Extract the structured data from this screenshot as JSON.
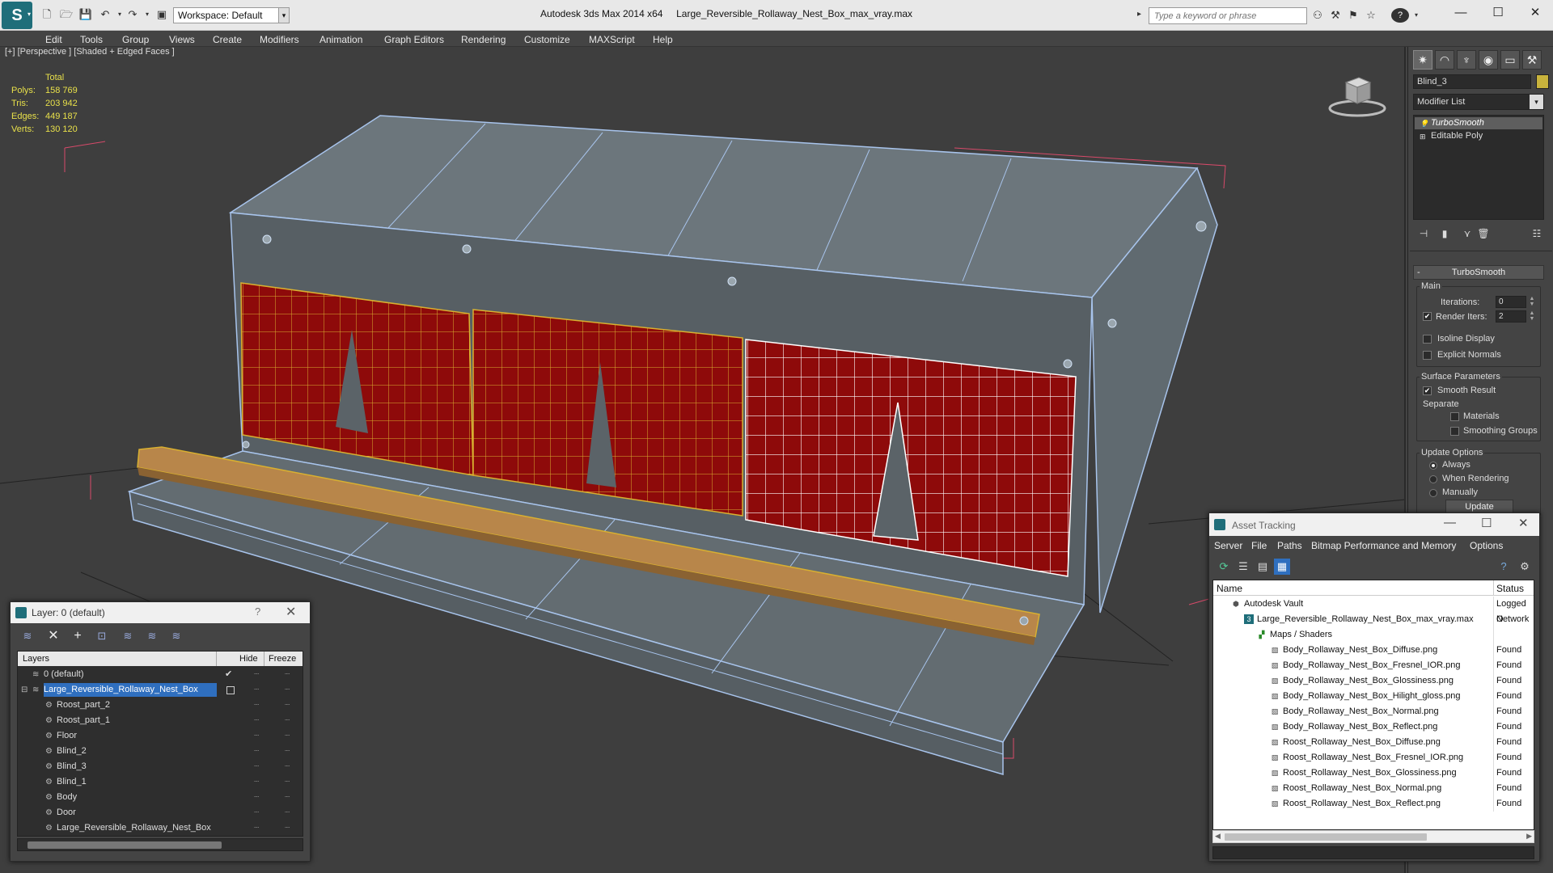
{
  "app": {
    "title": "Autodesk 3ds Max  2014 x64",
    "file": "Large_Reversible_Rollaway_Nest_Box_max_vray.max",
    "workspace": "Workspace: Default",
    "search_placeholder": "Type a keyword or phrase"
  },
  "menu": [
    "Edit",
    "Tools",
    "Group",
    "Views",
    "Create",
    "Modifiers",
    "Animation",
    "Graph Editors",
    "Rendering",
    "Customize",
    "MAXScript",
    "Help"
  ],
  "viewport": {
    "label": "[+] [Perspective ] [Shaded + Edged Faces ]",
    "stats": {
      "header": "Total",
      "rows": [
        {
          "label": "Polys:",
          "value": "158 769"
        },
        {
          "label": "Tris:",
          "value": "203 942"
        },
        {
          "label": "Edges:",
          "value": "449 187"
        },
        {
          "label": "Verts:",
          "value": "130 120"
        }
      ]
    }
  },
  "command_panel": {
    "object_name": "Blind_3",
    "modifier_list": "Modifier List",
    "stack": [
      "TurboSmooth",
      "Editable Poly"
    ],
    "rollout_title": "TurboSmooth",
    "main_label": "Main",
    "iterations_label": "Iterations:",
    "iterations_value": "0",
    "render_iters_label": "Render Iters:",
    "render_iters_value": "2",
    "isoline_label": "Isoline Display",
    "explicit_normals_label": "Explicit Normals",
    "surface_params_label": "Surface Parameters",
    "smooth_result_label": "Smooth Result",
    "separate_label": "Separate",
    "materials_label": "Materials",
    "smoothing_groups_label": "Smoothing Groups",
    "update_options_label": "Update Options",
    "always_label": "Always",
    "when_rendering_label": "When Rendering",
    "manually_label": "Manually",
    "update_button": "Update"
  },
  "layer_dialog": {
    "title": "Layer: 0 (default)",
    "help": "?",
    "col_layers": "Layers",
    "col_hide": "Hide",
    "col_freeze": "Freeze",
    "rows": [
      {
        "name": "0 (default)",
        "indent": 0
      },
      {
        "name": "Large_Reversible_Rollaway_Nest_Box",
        "indent": 0
      },
      {
        "name": "Roost_part_2",
        "indent": 1
      },
      {
        "name": "Roost_part_1",
        "indent": 1
      },
      {
        "name": "Floor",
        "indent": 1
      },
      {
        "name": "Blind_2",
        "indent": 1
      },
      {
        "name": "Blind_3",
        "indent": 1
      },
      {
        "name": "Blind_1",
        "indent": 1
      },
      {
        "name": "Body",
        "indent": 1
      },
      {
        "name": "Door",
        "indent": 1
      },
      {
        "name": "Large_Reversible_Rollaway_Nest_Box",
        "indent": 1
      }
    ]
  },
  "asset_dialog": {
    "title": "Asset Tracking",
    "menu": [
      "Server",
      "File",
      "Paths",
      "Bitmap Performance and Memory",
      "Options"
    ],
    "col_name": "Name",
    "col_status": "Status",
    "rows": [
      {
        "name": "Autodesk Vault",
        "status": "Logged O",
        "indent": 0
      },
      {
        "name": "Large_Reversible_Rollaway_Nest_Box_max_vray.max",
        "status": "Network",
        "indent": 1
      },
      {
        "name": "Maps / Shaders",
        "status": "",
        "indent": 2
      },
      {
        "name": "Body_Rollaway_Nest_Box_Diffuse.png",
        "status": "Found",
        "indent": 3
      },
      {
        "name": "Body_Rollaway_Nest_Box_Fresnel_IOR.png",
        "status": "Found",
        "indent": 3
      },
      {
        "name": "Body_Rollaway_Nest_Box_Glossiness.png",
        "status": "Found",
        "indent": 3
      },
      {
        "name": "Body_Rollaway_Nest_Box_Hilight_gloss.png",
        "status": "Found",
        "indent": 3
      },
      {
        "name": "Body_Rollaway_Nest_Box_Normal.png",
        "status": "Found",
        "indent": 3
      },
      {
        "name": "Body_Rollaway_Nest_Box_Reflect.png",
        "status": "Found",
        "indent": 3
      },
      {
        "name": "Roost_Rollaway_Nest_Box_Diffuse.png",
        "status": "Found",
        "indent": 3
      },
      {
        "name": "Roost_Rollaway_Nest_Box_Fresnel_IOR.png",
        "status": "Found",
        "indent": 3
      },
      {
        "name": "Roost_Rollaway_Nest_Box_Glossiness.png",
        "status": "Found",
        "indent": 3
      },
      {
        "name": "Roost_Rollaway_Nest_Box_Normal.png",
        "status": "Found",
        "indent": 3
      },
      {
        "name": "Roost_Rollaway_Nest_Box_Reflect.png",
        "status": "Found",
        "indent": 3
      }
    ]
  },
  "colors": {
    "stats_text": "#e8e04a",
    "blind_red": "#8e0a0a",
    "selection_blue": "#2f6fbf",
    "roost_wood": "#b8864a",
    "object_color": "#c8b33c"
  }
}
